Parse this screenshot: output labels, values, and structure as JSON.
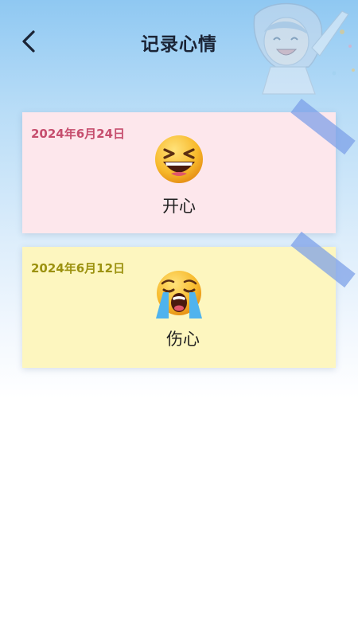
{
  "header": {
    "title": "记录心情",
    "back_icon": "chevron-left-icon"
  },
  "decor": {
    "character_icon": "cheering-girl-illustration"
  },
  "records": [
    {
      "date": "2024年6月24日",
      "mood": "开心",
      "emoji": "grinning-squinting-face-icon",
      "card_color": "#fde7ec",
      "date_color": "#c64e6e"
    },
    {
      "date": "2024年6月12日",
      "mood": "伤心",
      "emoji": "loudly-crying-face-icon",
      "card_color": "#fdf6bf",
      "date_color": "#9c9210"
    }
  ],
  "colors": {
    "tape": "#7a9ee8",
    "title": "#1b2436",
    "background_top": "#8fc8f2"
  }
}
